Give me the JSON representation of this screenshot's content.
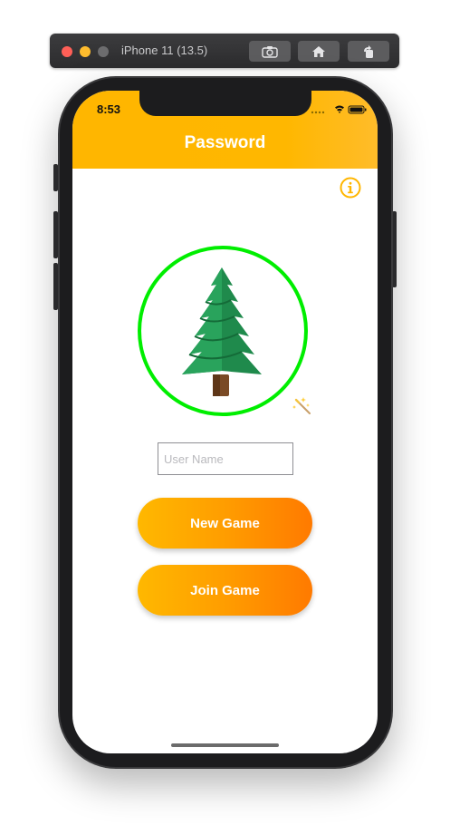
{
  "simulator": {
    "title": "iPhone 11 (13.5)",
    "buttons": [
      "screenshot-icon",
      "home-icon",
      "rotate-icon"
    ]
  },
  "status_bar": {
    "time": "8:53",
    "icons": [
      "signal-icon",
      "wifi-icon",
      "battery-icon"
    ]
  },
  "nav": {
    "title": "Password"
  },
  "main": {
    "info_icon": "info-icon",
    "avatar": {
      "emoji_name": "evergreen-tree",
      "ring_color": "#00ee00"
    },
    "wand_icon": "magic-wand-icon",
    "username": {
      "placeholder": "User Name",
      "value": ""
    },
    "new_game_label": "New Game",
    "join_game_label": "Join Game"
  },
  "colors": {
    "accent": "#ffb600",
    "button_gradient_start": "#ffb800",
    "button_gradient_end": "#ff7a00"
  }
}
